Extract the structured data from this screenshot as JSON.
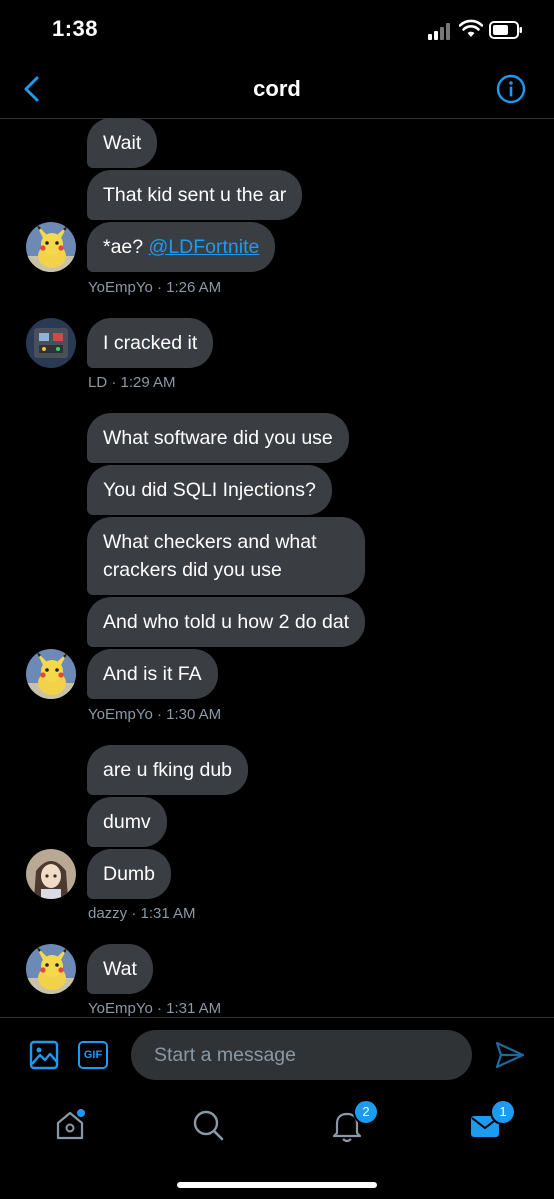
{
  "status_bar": {
    "time": "1:38"
  },
  "header": {
    "title": "cord"
  },
  "messages": [
    {
      "text": "Wait"
    },
    {
      "text": "That kid sent u the ar"
    },
    {
      "text": "*ae? ",
      "mention": "@LDFortnite"
    },
    {
      "meta": "YoEmpYo · 1:26 AM"
    },
    {
      "text": "I cracked it"
    },
    {
      "meta": "LD · 1:29 AM"
    },
    {
      "text": "What software did you use"
    },
    {
      "text": "You did SQLI Injections?"
    },
    {
      "text": "What checkers and what crackers did you use"
    },
    {
      "text": "And who told u how 2 do dat"
    },
    {
      "text": "And is it FA"
    },
    {
      "meta": "YoEmpYo · 1:30 AM"
    },
    {
      "text": "are u fking dub"
    },
    {
      "text": "dumv"
    },
    {
      "text": "Dumb"
    },
    {
      "meta": "dazzy · 1:31 AM"
    },
    {
      "text": "Wat"
    },
    {
      "meta": "YoEmpYo · 1:31 AM"
    }
  ],
  "composer": {
    "placeholder": "Start a message",
    "gif_label": "GIF"
  },
  "tabs": {
    "notifications_badge": "2",
    "messages_badge": "1"
  },
  "colors": {
    "accent": "#1d9bf0",
    "bubble": "#3a3d42",
    "meta": "#8b98a5"
  }
}
